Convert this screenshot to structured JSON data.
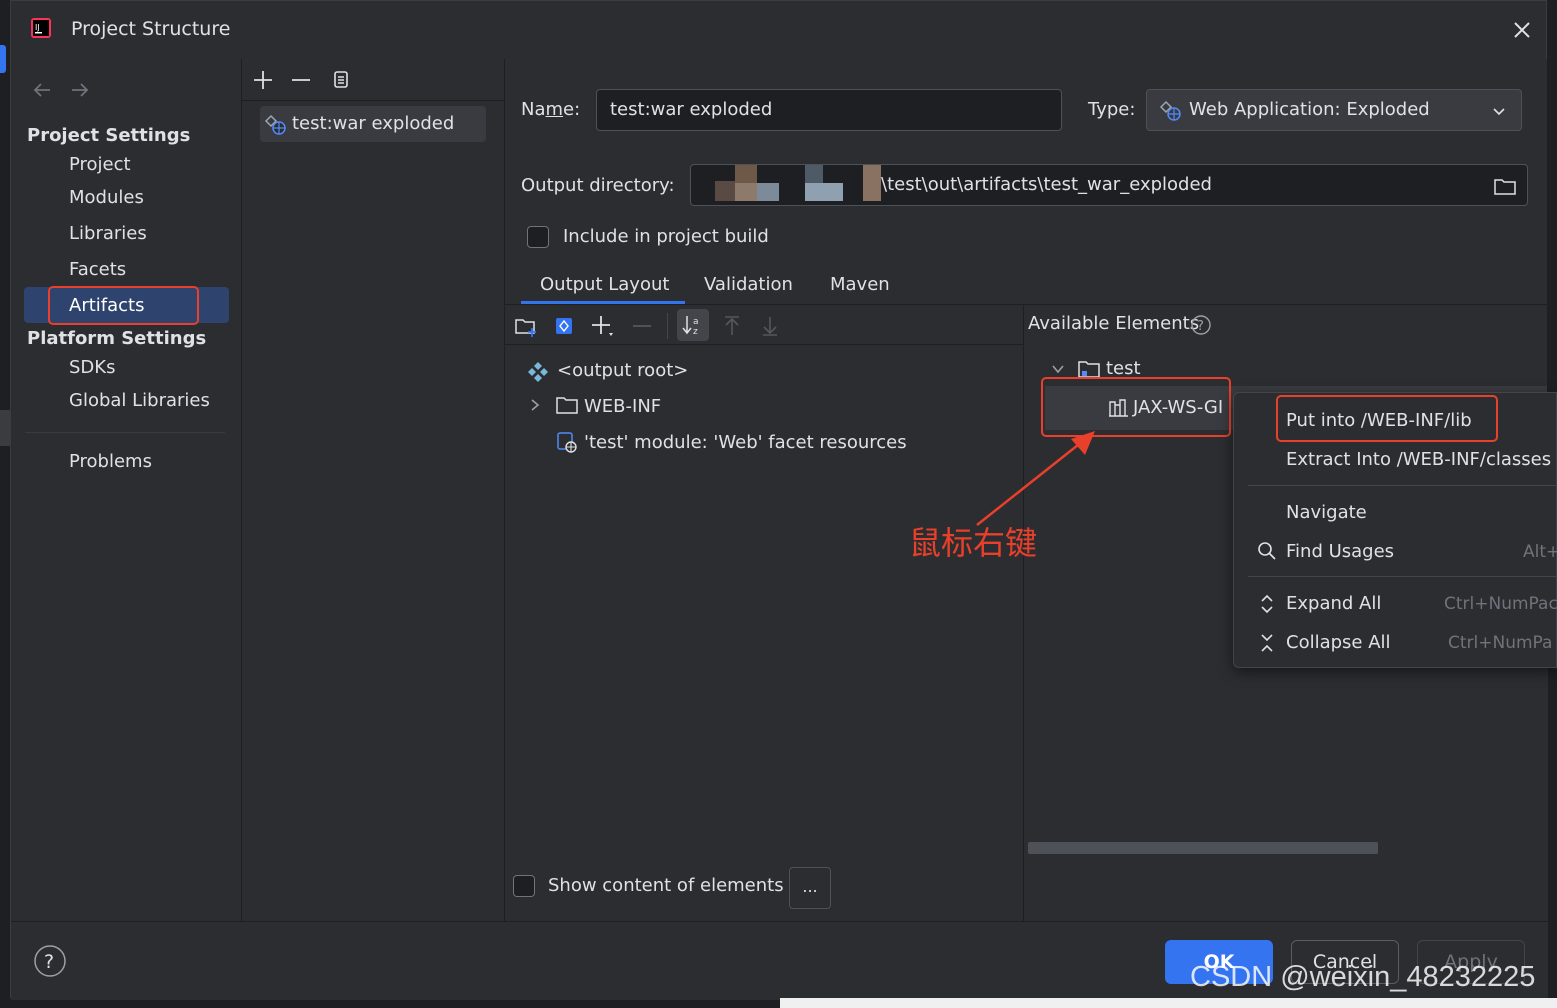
{
  "dialog": {
    "title": "Project Structure",
    "close_icon": "close-icon"
  },
  "nav": {
    "project_settings_header": "Project Settings",
    "platform_settings_header": "Platform Settings",
    "items": [
      "Project",
      "Modules",
      "Libraries",
      "Facets",
      "Artifacts"
    ],
    "platform_items": [
      "SDKs",
      "Global Libraries"
    ],
    "problems": "Problems",
    "selected": "Artifacts"
  },
  "artifact_list": {
    "items": [
      "test:war exploded"
    ]
  },
  "form": {
    "name_label_pre": "Na",
    "name_label_u": "m",
    "name_label_post": "e:",
    "name_value": "test:war exploded",
    "type_label": "Type:",
    "type_value": "Web Application: Exploded",
    "output_dir_label": "Output directory:",
    "output_dir_value": "\\test\\out\\artifacts\\test_war_exploded",
    "include_label": "Include in project build",
    "include_checked": false
  },
  "tabs": [
    "Output Layout",
    "Validation",
    "Maven"
  ],
  "active_tab": "Output Layout",
  "output_tree": {
    "root": "<output root>",
    "webinf": "WEB-INF",
    "resources": "'test' module: 'Web' facet resources"
  },
  "available": {
    "label": "Available Elements",
    "folder": "test",
    "item": "JAX-WS-GI"
  },
  "annotation": {
    "text": "鼠标右键",
    "color": "#e8402a"
  },
  "context_menu": {
    "items": [
      {
        "label": "Put into /WEB-INF/lib",
        "shortcut": ""
      },
      {
        "label": "Extract Into /WEB-INF/classes",
        "shortcut": ""
      },
      {
        "label": "Navigate",
        "shortcut": ""
      },
      {
        "label": "Find Usages",
        "shortcut": "Alt+"
      },
      {
        "label": "Expand All",
        "shortcut": "Ctrl+NumPac"
      },
      {
        "label": "Collapse All",
        "shortcut": "Ctrl+NumPa"
      }
    ]
  },
  "show_content_label": "Show content of elements",
  "ellipsis_button": "...",
  "buttons": {
    "ok": "OK",
    "cancel": "Cancel",
    "apply": "Apply"
  },
  "watermark": "CSDN @weixin_48232225",
  "colors": {
    "accent": "#3574f0",
    "highlight_red": "#e8402a",
    "selection": "#2e436e"
  }
}
